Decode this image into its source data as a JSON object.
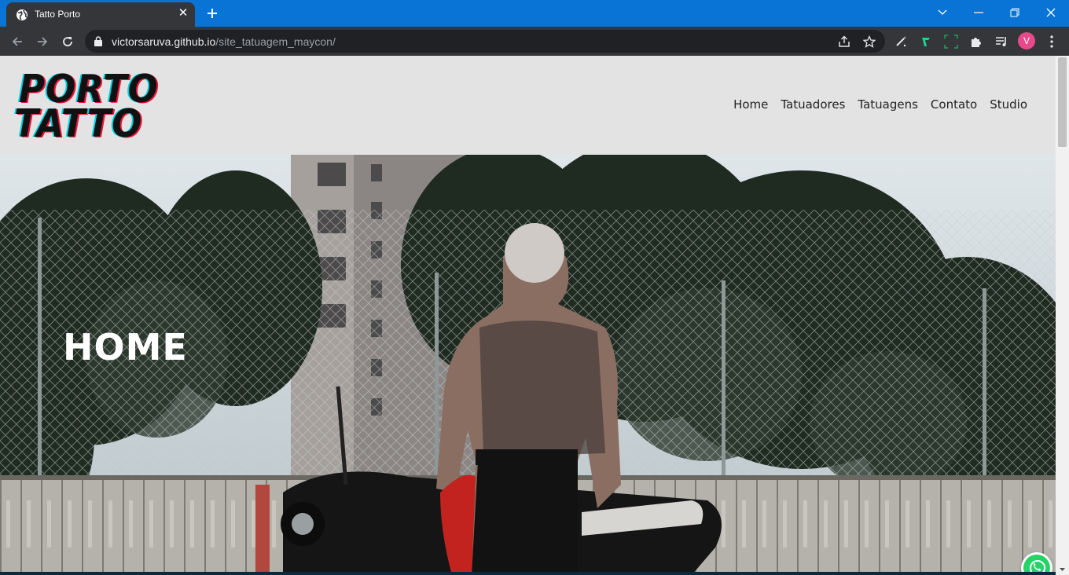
{
  "browser": {
    "tab_title": "Tatto Porto",
    "tab_close": "✕",
    "url_host": "victorsaruva.github.io",
    "url_path": "/site_tatuagem_maycon/",
    "profile_initial": "V",
    "colors": {
      "titlebar": "#0a74d6",
      "toolbar": "#35363a",
      "omnibox": "#202124",
      "avatar": "#e8498a"
    }
  },
  "site": {
    "logo": {
      "line1": "PORTO",
      "line2": "TATTO"
    },
    "nav": [
      {
        "label": "Home"
      },
      {
        "label": "Tatuadores"
      },
      {
        "label": "Tatuagens"
      },
      {
        "label": "Contato"
      },
      {
        "label": "Studio"
      }
    ],
    "hero": {
      "title": "HOME"
    },
    "colors": {
      "header_bg": "#e3e3e3",
      "logo_cyan": "#00d4e4",
      "logo_red": "#e8163a",
      "whatsapp": "#25d366"
    }
  }
}
